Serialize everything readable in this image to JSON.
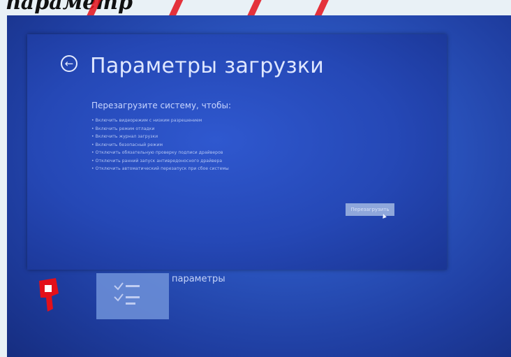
{
  "watermark": {
    "text": "параметр"
  },
  "dialog": {
    "back_icon": "arrow-left-circle-icon",
    "title": "Параметры загрузки",
    "subtitle": "Перезагрузите систему, чтобы:",
    "options": [
      "Включить видеорежим с низким разрешением",
      "Включить режим отладки",
      "Включить журнал загрузки",
      "Включить безопасный режим",
      "Отключить обязательную проверку подписи драйверов",
      "Отключить ранний запуск антивредоносного драйвера",
      "Отключить автоматический перезапуск при сбое системы"
    ],
    "restart_label": "Перезагрузить"
  },
  "background_tile": {
    "label": "параметры",
    "icon": "settings-list-icon"
  },
  "colors": {
    "screen_blue": "#2548b6",
    "watermark_red": "#e3101a",
    "banner_bg": "#e9f1f6"
  }
}
